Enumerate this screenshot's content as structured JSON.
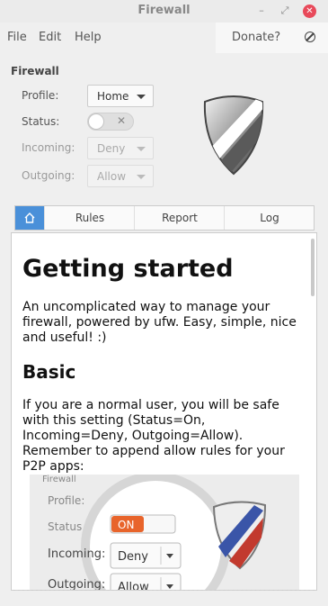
{
  "window": {
    "title": "Firewall"
  },
  "menu": {
    "file": "File",
    "edit": "Edit",
    "help": "Help",
    "donate": "Donate?"
  },
  "firewall": {
    "section_title": "Firewall",
    "profile_label": "Profile:",
    "profile_value": "Home",
    "status_label": "Status:",
    "status_on": false,
    "incoming_label": "Incoming:",
    "incoming_value": "Deny",
    "outgoing_label": "Outgoing:",
    "outgoing_value": "Allow"
  },
  "tabs": {
    "home": "home-icon",
    "rules": "Rules",
    "report": "Report",
    "log": "Log"
  },
  "doc": {
    "h1": "Getting started",
    "p1": "An uncomplicated way to manage your firewall, powered by ufw. Easy, simple, nice and useful! :)",
    "h2": "Basic",
    "p2": "If you are a normal user, you will be safe with this setting (Status=On, Incoming=Deny, Outgoing=Allow). Remember to append allow rules for your P2P apps:",
    "illus": {
      "title": "Firewall",
      "profile": "Profile:",
      "status": "Status",
      "incoming": "Incoming:",
      "outgoing": "Outgoing:",
      "on": "ON",
      "deny": "Deny",
      "allow": "Allow"
    }
  }
}
